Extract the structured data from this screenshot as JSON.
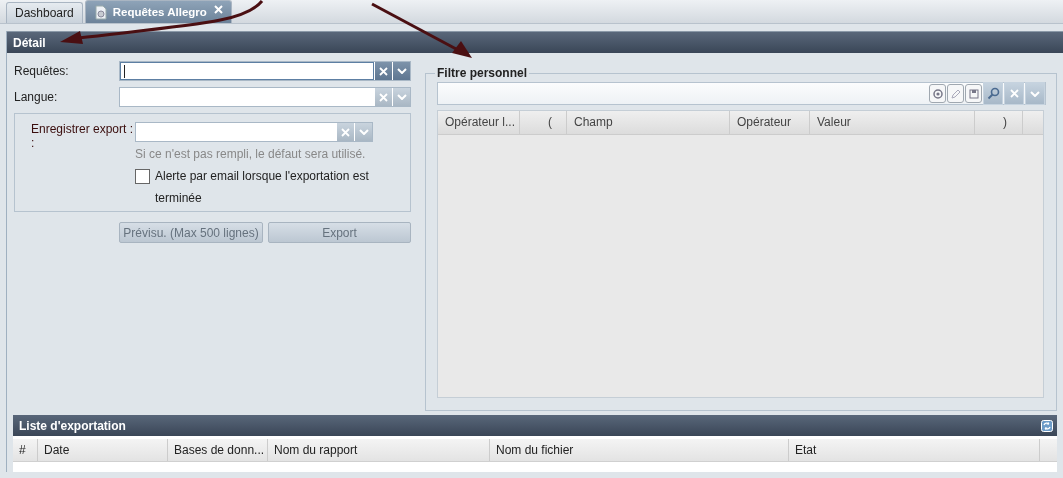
{
  "tabs": [
    {
      "label": "Dashboard",
      "selected": false,
      "closable": false
    },
    {
      "label": "Requêtes Allegro",
      "selected": true,
      "closable": true
    }
  ],
  "detail_panel": {
    "title": "Détail",
    "fields": [
      {
        "label": "Requêtes:",
        "focused": true
      },
      {
        "label": "Langue:",
        "focused": false
      }
    ],
    "export_box": {
      "label": "Enregistrer export : :",
      "hint": "Si ce n'est pas rempli, le défaut sera utilisé.",
      "alert_checkbox": {
        "label": "Alerte par email lorsque l'exportation est terminée",
        "checked": false
      }
    },
    "buttons": [
      {
        "label": "Prévisu. (Max 500 lignes)",
        "disabled": true
      },
      {
        "label": "Export",
        "disabled": true
      }
    ],
    "filter": {
      "legend": "Filtre personnel",
      "columns": [
        "Opérateur l...",
        "(",
        "Champ",
        "Opérateur",
        "Valeur",
        ")"
      ]
    }
  },
  "export_list": {
    "title": "Liste d'exportation",
    "columns": [
      "#",
      "Date",
      "Bases de donn...",
      "Nom du rapport",
      "Nom du fichier",
      "Etat"
    ]
  }
}
